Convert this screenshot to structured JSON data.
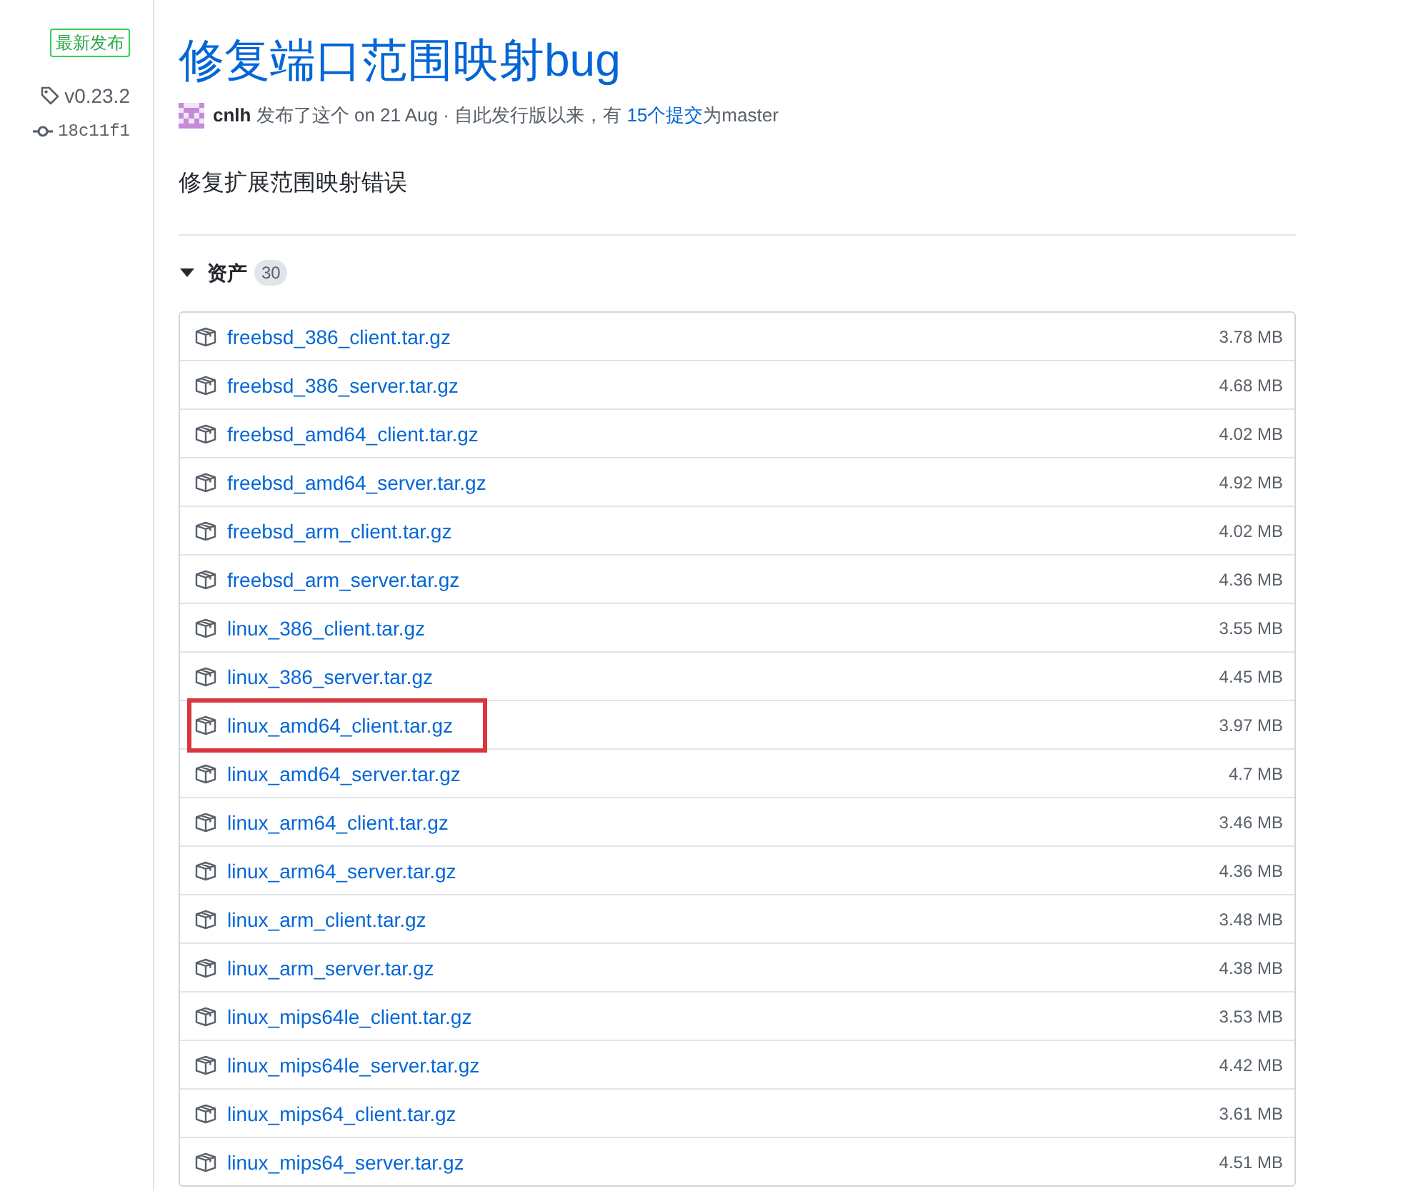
{
  "sidebar": {
    "badge": "最新发布",
    "tag": "v0.23.2",
    "commit": "18c11f1"
  },
  "release": {
    "title": "修复端口范围映射bug",
    "meta": {
      "before": "**cnlh** 发布了这个 on 21 Aug · 自此发行版以来，有",
      "link": "15个提交",
      "after": "为master"
    },
    "description": "修复扩展范围映射错误"
  },
  "assets": {
    "label": "资产",
    "count": "30",
    "expanded": true,
    "items": [
      {
        "name": "freebsd_386_client.tar.gz",
        "size": "3.78 MB",
        "highlighted": false
      },
      {
        "name": "freebsd_386_server.tar.gz",
        "size": "4.68 MB",
        "highlighted": false
      },
      {
        "name": "freebsd_amd64_client.tar.gz",
        "size": "4.02 MB",
        "highlighted": false
      },
      {
        "name": "freebsd_amd64_server.tar.gz",
        "size": "4.92 MB",
        "highlighted": false
      },
      {
        "name": "freebsd_arm_client.tar.gz",
        "size": "4.02 MB",
        "highlighted": false
      },
      {
        "name": "freebsd_arm_server.tar.gz",
        "size": "4.36 MB",
        "highlighted": false
      },
      {
        "name": "linux_386_client.tar.gz",
        "size": "3.55 MB",
        "highlighted": false
      },
      {
        "name": "linux_386_server.tar.gz",
        "size": "4.45 MB",
        "highlighted": false
      },
      {
        "name": "linux_amd64_client.tar.gz",
        "size": "3.97 MB",
        "highlighted": true
      },
      {
        "name": "linux_amd64_server.tar.gz",
        "size": "4.7 MB",
        "highlighted": false
      },
      {
        "name": "linux_arm64_client.tar.gz",
        "size": "3.46 MB",
        "highlighted": false
      },
      {
        "name": "linux_arm64_server.tar.gz",
        "size": "4.36 MB",
        "highlighted": false
      },
      {
        "name": "linux_arm_client.tar.gz",
        "size": "3.48 MB",
        "highlighted": false
      },
      {
        "name": "linux_arm_server.tar.gz",
        "size": "4.38 MB",
        "highlighted": false
      },
      {
        "name": "linux_mips64le_client.tar.gz",
        "size": "3.53 MB",
        "highlighted": false
      },
      {
        "name": "linux_mips64le_server.tar.gz",
        "size": "4.42 MB",
        "highlighted": false
      },
      {
        "name": "linux_mips64_client.tar.gz",
        "size": "3.61 MB",
        "highlighted": false
      },
      {
        "name": "linux_mips64_server.tar.gz",
        "size": "4.51 MB",
        "highlighted": false
      }
    ]
  }
}
